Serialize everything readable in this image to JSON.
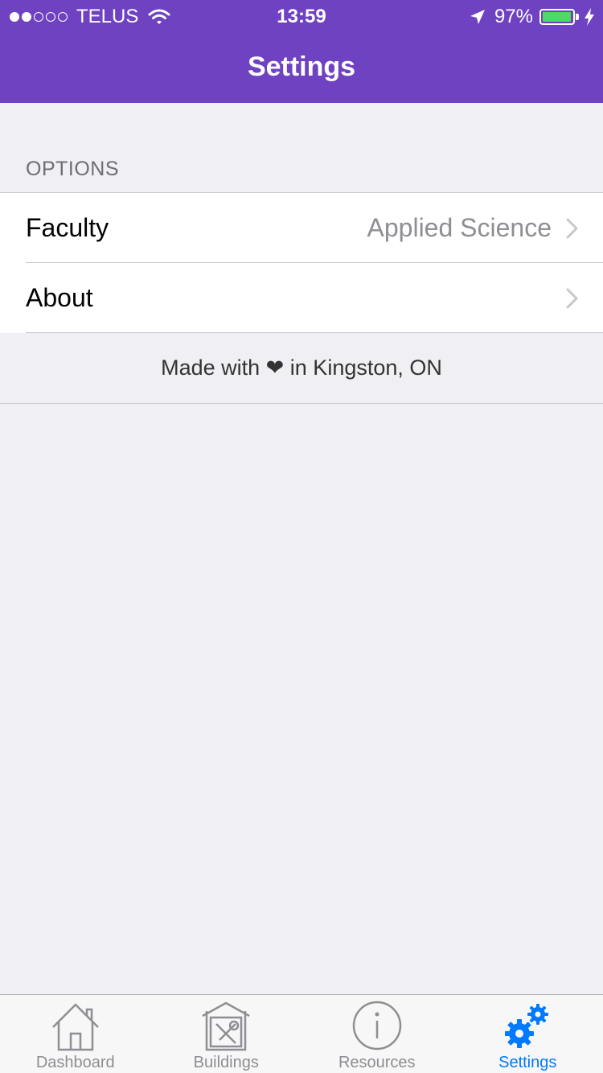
{
  "status_bar": {
    "carrier": "TELUS",
    "signal_filled": 2,
    "signal_total": 5,
    "time": "13:59",
    "battery_percent": "97%",
    "battery_level": 0.97,
    "battery_color": "#4cd964"
  },
  "nav": {
    "title": "Settings",
    "color": "#6f42c1"
  },
  "options": {
    "header": "OPTIONS",
    "rows": [
      {
        "label": "Faculty",
        "value": "Applied Science"
      },
      {
        "label": "About",
        "value": ""
      }
    ]
  },
  "footer": {
    "note": "Made with ❤ in Kingston, ON"
  },
  "tabbar": {
    "active_color": "#007aff",
    "tabs": [
      {
        "label": "Dashboard",
        "icon": "house-icon"
      },
      {
        "label": "Buildings",
        "icon": "building-tools-icon"
      },
      {
        "label": "Resources",
        "icon": "info-icon"
      },
      {
        "label": "Settings",
        "icon": "gears-icon",
        "active": true
      }
    ]
  }
}
